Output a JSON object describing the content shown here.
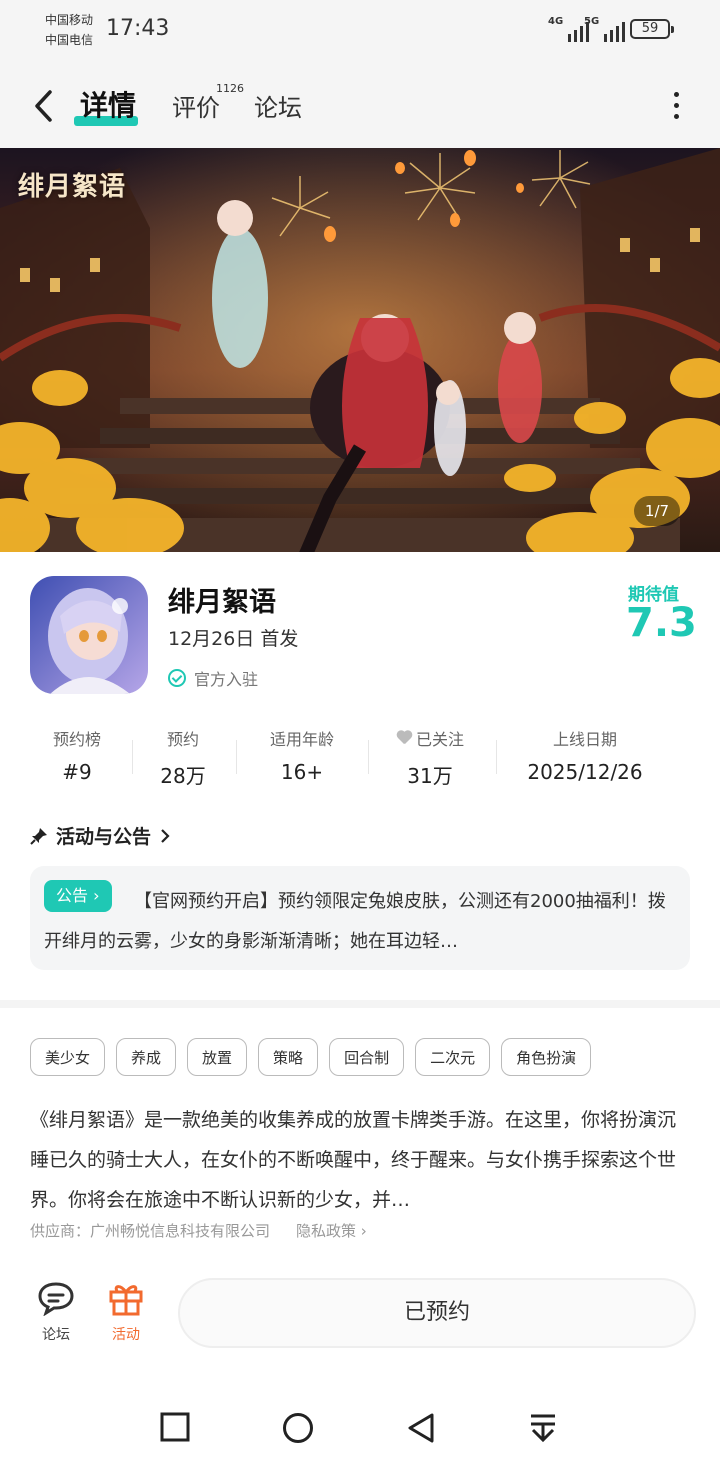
{
  "status_bar": {
    "carrier_1": "中国移动",
    "carrier_2": "中国电信",
    "time": "17:43",
    "net_1": "4G",
    "net_2": "5G",
    "battery": "59"
  },
  "nav": {
    "tabs": [
      {
        "label": "详情",
        "active": true
      },
      {
        "label": "评价",
        "count": "1126"
      },
      {
        "label": "论坛"
      }
    ]
  },
  "banner": {
    "logo_text": "绯月絮语",
    "counter": "1/7"
  },
  "app": {
    "name": "绯月絮语",
    "release": "12月26日 首发",
    "official": "官方入驻",
    "expect_label": "期待值",
    "expect_value": "7.3"
  },
  "stats": [
    {
      "label": "预约榜",
      "value": "#9"
    },
    {
      "label": "预约",
      "value": "28万"
    },
    {
      "label": "适用年龄",
      "value": "16+"
    },
    {
      "label": "已关注",
      "value": "31万"
    },
    {
      "label": "上线日期",
      "value": "2025/12/26"
    }
  ],
  "announcements": {
    "title": "活动与公告",
    "badge": "公告",
    "text": "【官网预约开启】预约领限定兔娘皮肤，公测还有2000抽福利！拨开绯月的云雾，少女的身影渐渐清晰；她在耳边轻…"
  },
  "tags": [
    "美少女",
    "养成",
    "放置",
    "策略",
    "回合制",
    "二次元",
    "角色扮演"
  ],
  "description": "《绯月絮语》是一款绝美的收集养成的放置卡牌类手游。在这里，你将扮演沉睡已久的骑士大人，在女仆的不断唤醒中，终于醒来。与女仆携手探索这个世界。你将会在旅途中不断认识新的少女，并…",
  "supplier": {
    "label": "供应商：广州畅悦信息科技有限公司",
    "privacy": "隐私政策"
  },
  "action_bar": {
    "forum": "论坛",
    "activity": "活动",
    "reserve_button": "已预约"
  },
  "colors": {
    "accent": "#1fc8b4",
    "activity": "#f26a2e"
  }
}
